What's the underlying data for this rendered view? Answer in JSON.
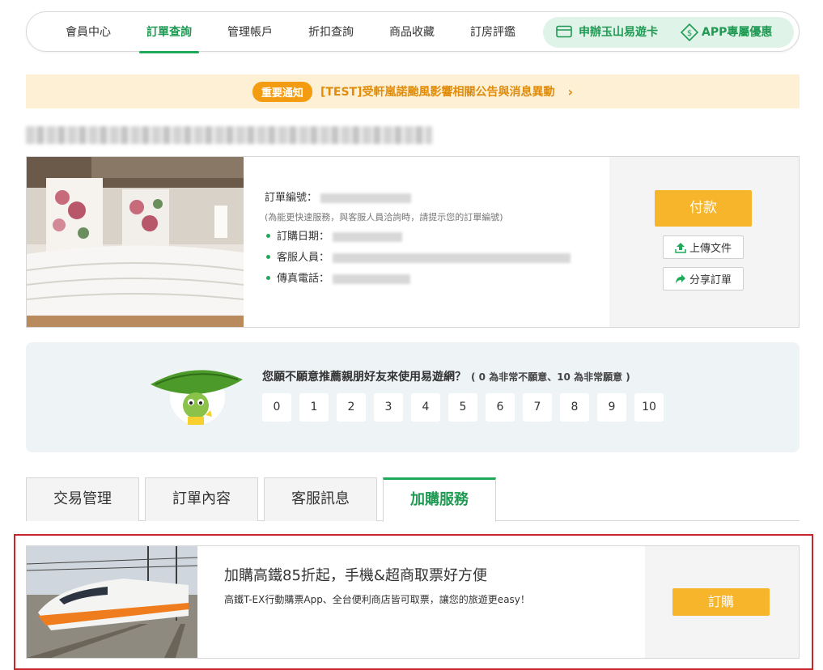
{
  "nav": {
    "tabs": [
      "會員中心",
      "訂單查詢",
      "管理帳戶",
      "折扣查詢",
      "商品收藏",
      "訂房評鑑"
    ],
    "active_tab": "訂單查詢",
    "promo_card": "申辦玉山易遊卡",
    "promo_app": "APP專屬優惠",
    "accent_color": "#1faa59"
  },
  "notice": {
    "badge": "重要通知",
    "text": "[TEST]受軒嵐諾颱風影響相關公告與消息異動",
    "chevron": "›"
  },
  "order": {
    "order_no_label": "訂單編號：",
    "note": "(為能更快速服務，與客服人員洽詢時，請提示您的訂單編號)",
    "date_label": "訂購日期：",
    "agent_label": "客服人員：",
    "fax_label": "傳真電話：",
    "pay_button": "付款",
    "upload_button": "上傳文件",
    "share_button": "分享訂單"
  },
  "nps": {
    "question": "您願不願意推薦親朋好友來使用易遊網？",
    "hint": "( 0 為非常不願意、10 為非常願意 )",
    "scores": [
      "0",
      "1",
      "2",
      "3",
      "4",
      "5",
      "6",
      "7",
      "8",
      "9",
      "10"
    ]
  },
  "tabs": {
    "items": [
      "交易管理",
      "訂單內容",
      "客服訊息",
      "加購服務"
    ],
    "active": "加購服務"
  },
  "addon": {
    "title": "加購高鐵85折起，手機&超商取票好方便",
    "desc": "高鐵T-EX行動購票App、全台便利商店皆可取票，讓您的旅遊更easy！",
    "buy_button": "訂購"
  },
  "colors": {
    "orange": "#f7b52c",
    "green": "#1faa59",
    "red_frame": "#c9242b"
  }
}
